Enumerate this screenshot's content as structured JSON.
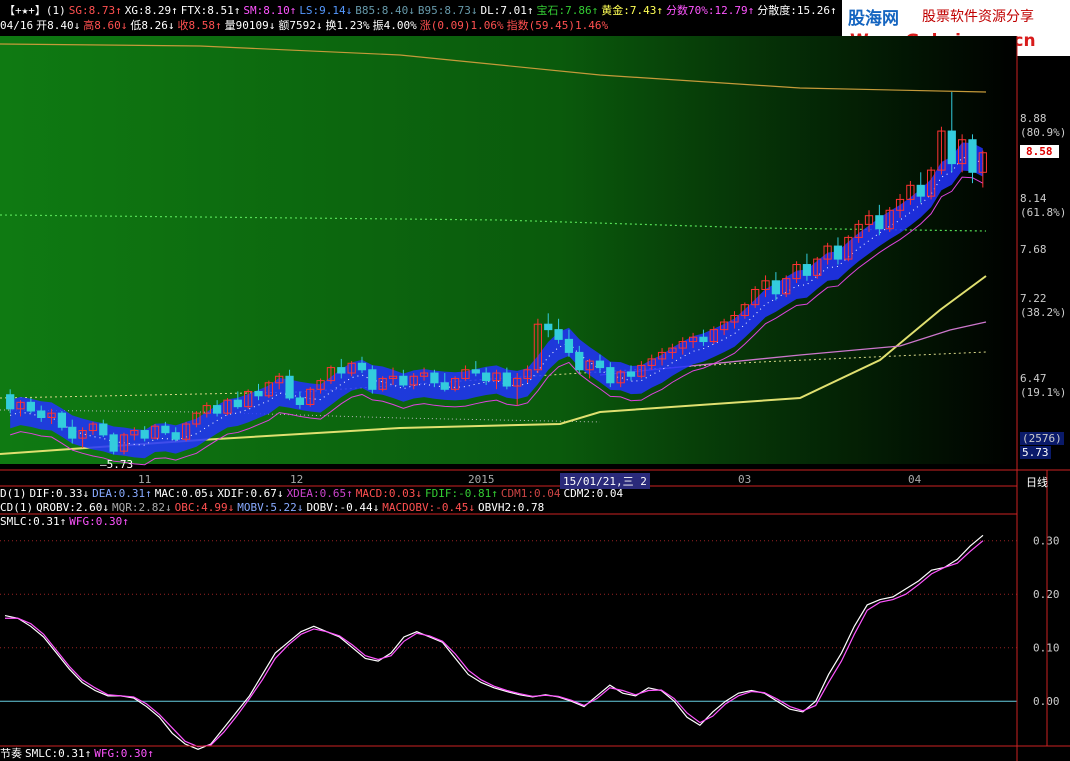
{
  "header1": [
    {
      "t": "【+★+】(1)",
      "c": "#ffffff"
    },
    {
      "t": "SG:8.73↑",
      "c": "#ff5050"
    },
    {
      "t": "XG:8.29↑",
      "c": "#ffffff"
    },
    {
      "t": "FTX:8.51↑",
      "c": "#ffffff"
    },
    {
      "t": "SM:8.10↑",
      "c": "#ff55ff"
    },
    {
      "t": "LS:9.14↓",
      "c": "#5599ff"
    },
    {
      "t": "B85:8.40↓",
      "c": "#6699aa"
    },
    {
      "t": "B95:8.73↓",
      "c": "#6699aa"
    },
    {
      "t": "DL:7.01↑",
      "c": "#ffffff"
    },
    {
      "t": "宝石:7.86↑",
      "c": "#33cc33"
    },
    {
      "t": "黄金:7.43↑",
      "c": "#ffff55"
    },
    {
      "t": "分数70%:12.79↑",
      "c": "#ff55ff"
    },
    {
      "t": "分散度:15.26↑",
      "c": "#ffffff"
    }
  ],
  "header2": [
    {
      "t": "04/16",
      "c": "#ffffff"
    },
    {
      "t": "开8.40↓",
      "c": "#ffffff"
    },
    {
      "t": "高8.60↓",
      "c": "#ff5050"
    },
    {
      "t": "低8.26↓",
      "c": "#ffffff"
    },
    {
      "t": "收8.58↑",
      "c": "#ff5050"
    },
    {
      "t": "量90109↓",
      "c": "#ffffff"
    },
    {
      "t": "额7592↓",
      "c": "#ffffff"
    },
    {
      "t": "换1.23%",
      "c": "#ffffff"
    },
    {
      "t": "振4.00%",
      "c": "#ffffff"
    },
    {
      "t": "涨(0.09)1.06%",
      "c": "#ff5050"
    },
    {
      "t": "指数(59.45)1.46%",
      "c": "#ff5050"
    }
  ],
  "logo": {
    "name": "股海网",
    "slogan": "股票软件资源分享",
    "url": "Www.Guhai.com.cn"
  },
  "x_axis": [
    "11",
    "12",
    "2015",
    "15/01/21,三 2",
    "03",
    "04"
  ],
  "period": "日线",
  "price_axis": {
    "labels": [
      {
        "v": "8.88",
        "c": "#cccccc"
      },
      {
        "v": "(80.9%)",
        "c": "#cccccc"
      },
      {
        "v": "8.14",
        "c": "#cccccc"
      },
      {
        "v": "(61.8%)",
        "c": "#cccccc"
      },
      {
        "v": "7.68",
        "c": "#cccccc"
      },
      {
        "v": "7.22",
        "c": "#cccccc"
      },
      {
        "v": "(38.2%)",
        "c": "#cccccc"
      },
      {
        "v": "6.47",
        "c": "#cccccc"
      },
      {
        "v": "(19.1%)",
        "c": "#cccccc"
      },
      {
        "v": "(2576)",
        "c": "#cccccc"
      },
      {
        "v": "5.73",
        "c": "#ffffff"
      }
    ],
    "current": "8.58",
    "low_mark": "5.73"
  },
  "ind1": [
    {
      "t": "D(1)",
      "c": "#ffffff"
    },
    {
      "t": "DIF:0.33↓",
      "c": "#ffffff"
    },
    {
      "t": "DEA:0.31↑",
      "c": "#88aaff"
    },
    {
      "t": "MAC:0.05↓",
      "c": "#ffffff"
    },
    {
      "t": "XDIF:0.67↓",
      "c": "#ffffff"
    },
    {
      "t": "XDEA:0.65↑",
      "c": "#cc44cc"
    },
    {
      "t": "MACD:0.03↓",
      "c": "#ff5050"
    },
    {
      "t": "FDIF:-0.81↑",
      "c": "#33cc33"
    },
    {
      "t": "CDM1:0.04",
      "c": "#cc4444"
    },
    {
      "t": "CDM2:0.04",
      "c": "#ffffff"
    }
  ],
  "ind2": [
    {
      "t": "CD(1)",
      "c": "#ffffff"
    },
    {
      "t": "QROBV:2.60↓",
      "c": "#ffffff"
    },
    {
      "t": "MQR:2.82↓",
      "c": "#aaaaaa"
    },
    {
      "t": "OBC:4.99↓",
      "c": "#ff5050"
    },
    {
      "t": "MOBV:5.22↓",
      "c": "#88aaff"
    },
    {
      "t": "DOBV:-0.44↓",
      "c": "#ffffff"
    },
    {
      "t": "MACDOBV:-0.45↓",
      "c": "#ff5050"
    },
    {
      "t": "OBVH2:0.78",
      "c": "#ffffff"
    }
  ],
  "ind3": [
    {
      "t": "SMLC:0.31↑",
      "c": "#ffffff"
    },
    {
      "t": "WFG:0.30↑",
      "c": "#ff55ff"
    }
  ],
  "footer": [
    {
      "t": "节奏",
      "c": "#ffffff"
    },
    {
      "t": "SMLC:0.31↑",
      "c": "#ffffff"
    },
    {
      "t": "WFG:0.30↑",
      "c": "#ff55ff"
    }
  ],
  "chart_data": [
    {
      "type": "line",
      "title": "",
      "note": "daily candlestick price chart with support bands",
      "x_range": [
        "2014-10",
        "2015-04-16"
      ],
      "ylim": [
        5.73,
        9.14
      ],
      "ohlc": [
        [
          6.35,
          6.4,
          6.18,
          6.22
        ],
        [
          6.22,
          6.3,
          6.15,
          6.28
        ],
        [
          6.28,
          6.32,
          6.18,
          6.2
        ],
        [
          6.2,
          6.25,
          6.1,
          6.14
        ],
        [
          6.14,
          6.22,
          6.08,
          6.18
        ],
        [
          6.18,
          6.2,
          6.02,
          6.05
        ],
        [
          6.05,
          6.12,
          5.9,
          5.95
        ],
        [
          5.95,
          6.05,
          5.86,
          6.02
        ],
        [
          6.02,
          6.1,
          5.98,
          6.08
        ],
        [
          6.08,
          6.12,
          5.96,
          5.98
        ],
        [
          5.98,
          6.0,
          5.8,
          5.83
        ],
        [
          5.83,
          6.0,
          5.8,
          5.98
        ],
        [
          5.98,
          6.05,
          5.93,
          6.02
        ],
        [
          6.02,
          6.06,
          5.92,
          5.95
        ],
        [
          5.95,
          6.08,
          5.94,
          6.06
        ],
        [
          6.06,
          6.1,
          5.98,
          6.0
        ],
        [
          6.0,
          6.05,
          5.92,
          5.94
        ],
        [
          5.94,
          6.1,
          5.92,
          6.08
        ],
        [
          6.08,
          6.2,
          6.05,
          6.18
        ],
        [
          6.18,
          6.28,
          6.14,
          6.25
        ],
        [
          6.25,
          6.3,
          6.15,
          6.18
        ],
        [
          6.18,
          6.32,
          6.16,
          6.3
        ],
        [
          6.3,
          6.38,
          6.22,
          6.24
        ],
        [
          6.24,
          6.4,
          6.22,
          6.38
        ],
        [
          6.38,
          6.45,
          6.3,
          6.34
        ],
        [
          6.34,
          6.48,
          6.32,
          6.46
        ],
        [
          6.46,
          6.55,
          6.4,
          6.52
        ],
        [
          6.52,
          6.58,
          6.3,
          6.32
        ],
        [
          6.32,
          6.38,
          6.22,
          6.26
        ],
        [
          6.26,
          6.42,
          6.24,
          6.4
        ],
        [
          6.4,
          6.5,
          6.36,
          6.48
        ],
        [
          6.48,
          6.62,
          6.45,
          6.6
        ],
        [
          6.6,
          6.68,
          6.5,
          6.55
        ],
        [
          6.55,
          6.66,
          6.52,
          6.64
        ],
        [
          6.64,
          6.7,
          6.55,
          6.58
        ],
        [
          6.58,
          6.62,
          6.36,
          6.4
        ],
        [
          6.4,
          6.52,
          6.38,
          6.5
        ],
        [
          6.5,
          6.6,
          6.44,
          6.52
        ],
        [
          6.52,
          6.58,
          6.42,
          6.44
        ],
        [
          6.44,
          6.55,
          6.4,
          6.52
        ],
        [
          6.52,
          6.6,
          6.48,
          6.55
        ],
        [
          6.55,
          6.58,
          6.42,
          6.46
        ],
        [
          6.46,
          6.55,
          6.38,
          6.4
        ],
        [
          6.4,
          6.52,
          6.38,
          6.5
        ],
        [
          6.5,
          6.62,
          6.48,
          6.58
        ],
        [
          6.58,
          6.66,
          6.52,
          6.55
        ],
        [
          6.55,
          6.6,
          6.44,
          6.48
        ],
        [
          6.48,
          6.58,
          6.4,
          6.55
        ],
        [
          6.55,
          6.6,
          6.4,
          6.43
        ],
        [
          6.43,
          6.55,
          6.25,
          6.5
        ],
        [
          6.5,
          6.62,
          6.46,
          6.58
        ],
        [
          6.58,
          7.05,
          6.55,
          7.0
        ],
        [
          7.0,
          7.1,
          6.88,
          6.95
        ],
        [
          6.95,
          7.05,
          6.82,
          6.86
        ],
        [
          6.86,
          6.95,
          6.7,
          6.74
        ],
        [
          6.74,
          6.8,
          6.55,
          6.58
        ],
        [
          6.58,
          6.68,
          6.5,
          6.66
        ],
        [
          6.66,
          6.72,
          6.55,
          6.6
        ],
        [
          6.6,
          6.65,
          6.42,
          6.46
        ],
        [
          6.46,
          6.58,
          6.42,
          6.56
        ],
        [
          6.56,
          6.62,
          6.48,
          6.52
        ],
        [
          6.52,
          6.66,
          6.5,
          6.62
        ],
        [
          6.62,
          6.72,
          6.58,
          6.68
        ],
        [
          6.68,
          6.78,
          6.62,
          6.74
        ],
        [
          6.74,
          6.82,
          6.68,
          6.78
        ],
        [
          6.78,
          6.88,
          6.72,
          6.84
        ],
        [
          6.84,
          6.92,
          6.78,
          6.88
        ],
        [
          6.88,
          6.95,
          6.8,
          6.84
        ],
        [
          6.84,
          6.98,
          6.82,
          6.95
        ],
        [
          6.95,
          7.05,
          6.9,
          7.02
        ],
        [
          7.02,
          7.12,
          6.96,
          7.08
        ],
        [
          7.08,
          7.2,
          7.05,
          7.18
        ],
        [
          7.18,
          7.35,
          7.15,
          7.32
        ],
        [
          7.32,
          7.45,
          7.25,
          7.4
        ],
        [
          7.4,
          7.48,
          7.22,
          7.28
        ],
        [
          7.28,
          7.45,
          7.25,
          7.42
        ],
        [
          7.42,
          7.58,
          7.38,
          7.55
        ],
        [
          7.55,
          7.65,
          7.4,
          7.45
        ],
        [
          7.45,
          7.62,
          7.42,
          7.6
        ],
        [
          7.6,
          7.75,
          7.55,
          7.72
        ],
        [
          7.72,
          7.8,
          7.55,
          7.6
        ],
        [
          7.6,
          7.82,
          7.58,
          7.8
        ],
        [
          7.8,
          7.96,
          7.75,
          7.92
        ],
        [
          7.92,
          8.05,
          7.85,
          8.0
        ],
        [
          8.0,
          8.1,
          7.82,
          7.88
        ],
        [
          7.88,
          8.08,
          7.85,
          8.05
        ],
        [
          8.05,
          8.2,
          7.98,
          8.15
        ],
        [
          8.15,
          8.32,
          8.1,
          8.28
        ],
        [
          8.28,
          8.4,
          8.12,
          8.18
        ],
        [
          8.18,
          8.45,
          8.15,
          8.42
        ],
        [
          8.42,
          8.82,
          8.38,
          8.78
        ],
        [
          8.78,
          9.14,
          8.4,
          8.48
        ],
        [
          8.48,
          8.75,
          8.4,
          8.7
        ],
        [
          8.7,
          8.75,
          8.3,
          8.4
        ],
        [
          8.4,
          8.6,
          8.26,
          8.58
        ]
      ]
    },
    {
      "type": "line",
      "title": "",
      "ylim": [
        -0.08,
        0.32
      ],
      "series": [
        {
          "name": "SMLC",
          "values": [
            0.16,
            0.155,
            0.14,
            0.12,
            0.09,
            0.06,
            0.035,
            0.02,
            0.01,
            0.01,
            0.006,
            -0.01,
            -0.03,
            -0.06,
            -0.08,
            -0.09,
            -0.08,
            -0.05,
            -0.02,
            0.01,
            0.05,
            0.09,
            0.11,
            0.13,
            0.14,
            0.13,
            0.12,
            0.1,
            0.08,
            0.075,
            0.09,
            0.12,
            0.13,
            0.12,
            0.11,
            0.08,
            0.05,
            0.035,
            0.025,
            0.018,
            0.012,
            0.008,
            0.012,
            0.008,
            0.0,
            -0.01,
            0.01,
            0.03,
            0.015,
            0.01,
            0.025,
            0.02,
            0.0,
            -0.03,
            -0.045,
            -0.02,
            0.0,
            0.015,
            0.02,
            0.015,
            0.0,
            -0.015,
            -0.02,
            0.0,
            0.05,
            0.09,
            0.14,
            0.18,
            0.19,
            0.195,
            0.21,
            0.225,
            0.245,
            0.25,
            0.265,
            0.29,
            0.31
          ]
        },
        {
          "name": "WFG",
          "values": [
            0.155,
            0.155,
            0.145,
            0.125,
            0.095,
            0.065,
            0.04,
            0.025,
            0.012,
            0.01,
            0.008,
            -0.005,
            -0.025,
            -0.05,
            -0.075,
            -0.085,
            -0.082,
            -0.058,
            -0.028,
            0.005,
            0.04,
            0.08,
            0.105,
            0.125,
            0.135,
            0.13,
            0.122,
            0.105,
            0.085,
            0.078,
            0.085,
            0.112,
            0.127,
            0.122,
            0.112,
            0.088,
            0.058,
            0.04,
            0.028,
            0.02,
            0.014,
            0.009,
            0.011,
            0.009,
            0.002,
            -0.008,
            0.005,
            0.025,
            0.02,
            0.012,
            0.02,
            0.021,
            0.005,
            -0.022,
            -0.04,
            -0.028,
            -0.005,
            0.01,
            0.018,
            0.016,
            0.004,
            -0.01,
            -0.018,
            -0.008,
            0.035,
            0.075,
            0.125,
            0.17,
            0.185,
            0.19,
            0.2,
            0.218,
            0.238,
            0.25,
            0.258,
            0.28,
            0.3
          ]
        }
      ],
      "y_ticks": [
        "0.30",
        "0.20",
        "0.10",
        "0.00"
      ]
    }
  ],
  "ref_lines": {
    "gold": "#dede66",
    "purple": "#cc66cc",
    "band": "#2233ff",
    "up": "#ff3333",
    "down": "#33ccdd"
  }
}
